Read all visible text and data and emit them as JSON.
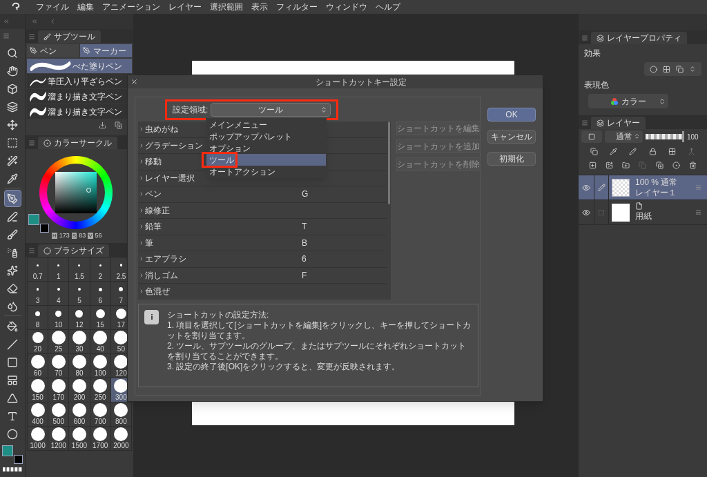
{
  "menu_bar": {
    "items": [
      "ファイル",
      "編集",
      "アニメーション",
      "レイヤー",
      "選択範囲",
      "表示",
      "フィルター",
      "ウィンドウ",
      "ヘルプ"
    ]
  },
  "toolbar": {
    "tools": [
      {
        "selected": false
      },
      {
        "selected": false
      },
      {
        "selected": false
      },
      {
        "selected": false
      },
      {
        "selected": false
      },
      {
        "selected": false
      },
      {
        "selected": false
      },
      {
        "selected": false
      },
      {
        "selected": true
      },
      {
        "selected": false
      },
      {
        "selected": false
      },
      {
        "selected": false
      },
      {
        "selected": false
      },
      {
        "selected": false
      },
      {
        "selected": false
      },
      {
        "selected": false
      },
      {
        "selected": false
      },
      {
        "selected": false
      },
      {
        "selected": false
      },
      {
        "selected": false
      },
      {
        "selected": false
      },
      {
        "selected": false
      }
    ],
    "colors": [
      {
        "color": "#1f8f86"
      },
      {
        "color": "#000000"
      }
    ]
  },
  "subtool_panel": {
    "title": "サブツール",
    "tabs": [
      {
        "label": "ペン",
        "selected": false
      },
      {
        "label": "マーカー",
        "selected": true
      }
    ],
    "brushes": [
      {
        "name": "べた塗りペン",
        "selected": true
      },
      {
        "name": "筆圧入り平ざらペン",
        "selected": false
      },
      {
        "name": "溜まり描き文字ペン",
        "selected": false
      },
      {
        "name": "溜まり描き文字ペン",
        "selected": false
      }
    ]
  },
  "color_panel": {
    "title": "カラーサークル",
    "colors": [
      {
        "color": "#1f8f86"
      },
      {
        "color": "#000000"
      }
    ],
    "hsv": [
      {
        "label": "H",
        "value": "173"
      },
      {
        "label": "S",
        "value": "83"
      },
      {
        "label": "V",
        "value": "56"
      }
    ]
  },
  "brush_size_panel": {
    "title": "ブラシサイズ",
    "sizes": [
      {
        "label": "0.7",
        "selected": false
      },
      {
        "label": "1",
        "selected": false
      },
      {
        "label": "1.5",
        "selected": false
      },
      {
        "label": "2",
        "selected": false
      },
      {
        "label": "2.5",
        "selected": false
      },
      {
        "label": "3",
        "selected": false
      },
      {
        "label": "4",
        "selected": false
      },
      {
        "label": "5",
        "selected": false
      },
      {
        "label": "6",
        "selected": false
      },
      {
        "label": "7",
        "selected": false
      },
      {
        "label": "8",
        "selected": false
      },
      {
        "label": "10",
        "selected": false
      },
      {
        "label": "12",
        "selected": false
      },
      {
        "label": "15",
        "selected": false
      },
      {
        "label": "17",
        "selected": false
      },
      {
        "label": "20",
        "selected": false
      },
      {
        "label": "25",
        "selected": false
      },
      {
        "label": "30",
        "selected": false
      },
      {
        "label": "40",
        "selected": false
      },
      {
        "label": "50",
        "selected": false
      },
      {
        "label": "60",
        "selected": false
      },
      {
        "label": "70",
        "selected": false
      },
      {
        "label": "80",
        "selected": false
      },
      {
        "label": "100",
        "selected": false
      },
      {
        "label": "120",
        "selected": false
      },
      {
        "label": "150",
        "selected": false
      },
      {
        "label": "170",
        "selected": false
      },
      {
        "label": "200",
        "selected": false
      },
      {
        "label": "250",
        "selected": false
      },
      {
        "label": "300",
        "selected": true
      },
      {
        "label": "400",
        "selected": false
      },
      {
        "label": "500",
        "selected": false
      },
      {
        "label": "600",
        "selected": false
      },
      {
        "label": "700",
        "selected": false
      },
      {
        "label": "800",
        "selected": false
      },
      {
        "label": "1000",
        "selected": false
      },
      {
        "label": "1200",
        "selected": false
      },
      {
        "label": "1500",
        "selected": false
      },
      {
        "label": "1700",
        "selected": false
      },
      {
        "label": "2000",
        "selected": false
      }
    ]
  },
  "dialog": {
    "title": "ショートカットキー設定",
    "area": {
      "label": "設定領域:",
      "value": "ツール",
      "highlighted": true
    },
    "dropdown_options": [
      {
        "label": "メインメニュー",
        "selected": false,
        "highlighted": false
      },
      {
        "label": "ポップアップパレット",
        "selected": false,
        "highlighted": false
      },
      {
        "label": "オプション",
        "selected": false,
        "highlighted": false
      },
      {
        "label": "ツール",
        "selected": true,
        "highlighted": true
      },
      {
        "label": "オートアクション",
        "selected": false,
        "highlighted": false
      }
    ],
    "rows": [
      {
        "name": "虫めがね"
      },
      {
        "name": "グラデーション"
      },
      {
        "name": "移動"
      },
      {
        "name": "レイヤー選択"
      },
      {
        "name": "ペン",
        "key": "G"
      },
      {
        "name": "線修正"
      },
      {
        "name": "鉛筆",
        "key": "T"
      },
      {
        "name": "筆",
        "key": "B"
      },
      {
        "name": "エアブラシ",
        "key": "6"
      },
      {
        "name": "消しゴム",
        "key": "F"
      },
      {
        "name": "色混ぜ"
      }
    ],
    "side_buttons": [
      {
        "label": "ショートカットを編集",
        "disabled": true
      },
      {
        "label": "ショートカットを追加",
        "disabled": true
      },
      {
        "label": "ショートカットを削除",
        "disabled": true
      }
    ],
    "buttons": [
      {
        "label": "OK",
        "selected": true
      },
      {
        "label": "キャンセル",
        "selected": false
      },
      {
        "label": "初期化",
        "selected": false
      }
    ],
    "info": {
      "title": "ショートカットの設定方法:",
      "lines": [
        "1. 項目を選択して[ショートカットを編集]をクリックし、キーを押してショートカットを割り当てます。",
        "2. ツール、サブツールのグループ、またはサブツールにそれぞれショートカットを割り当てることができます。",
        "3. 設定の終了後[OK]をクリックすると、変更が反映されます。"
      ]
    }
  },
  "layer_property_panel": {
    "title": "レイヤープロパティ",
    "effect_label": "効果",
    "color_label": "表現色",
    "color_mode": "カラー"
  },
  "layer_panel": {
    "title": "レイヤー",
    "blend_mode": "通常",
    "opacity": {
      "level": 1,
      "reading": "100"
    },
    "layers": [
      {
        "kind": "raster",
        "info": "100 % 通常",
        "name": "レイヤー１",
        "visible": true,
        "selected": true
      },
      {
        "kind": "paper",
        "name": "用紙",
        "visible": true,
        "selected": false
      }
    ]
  }
}
